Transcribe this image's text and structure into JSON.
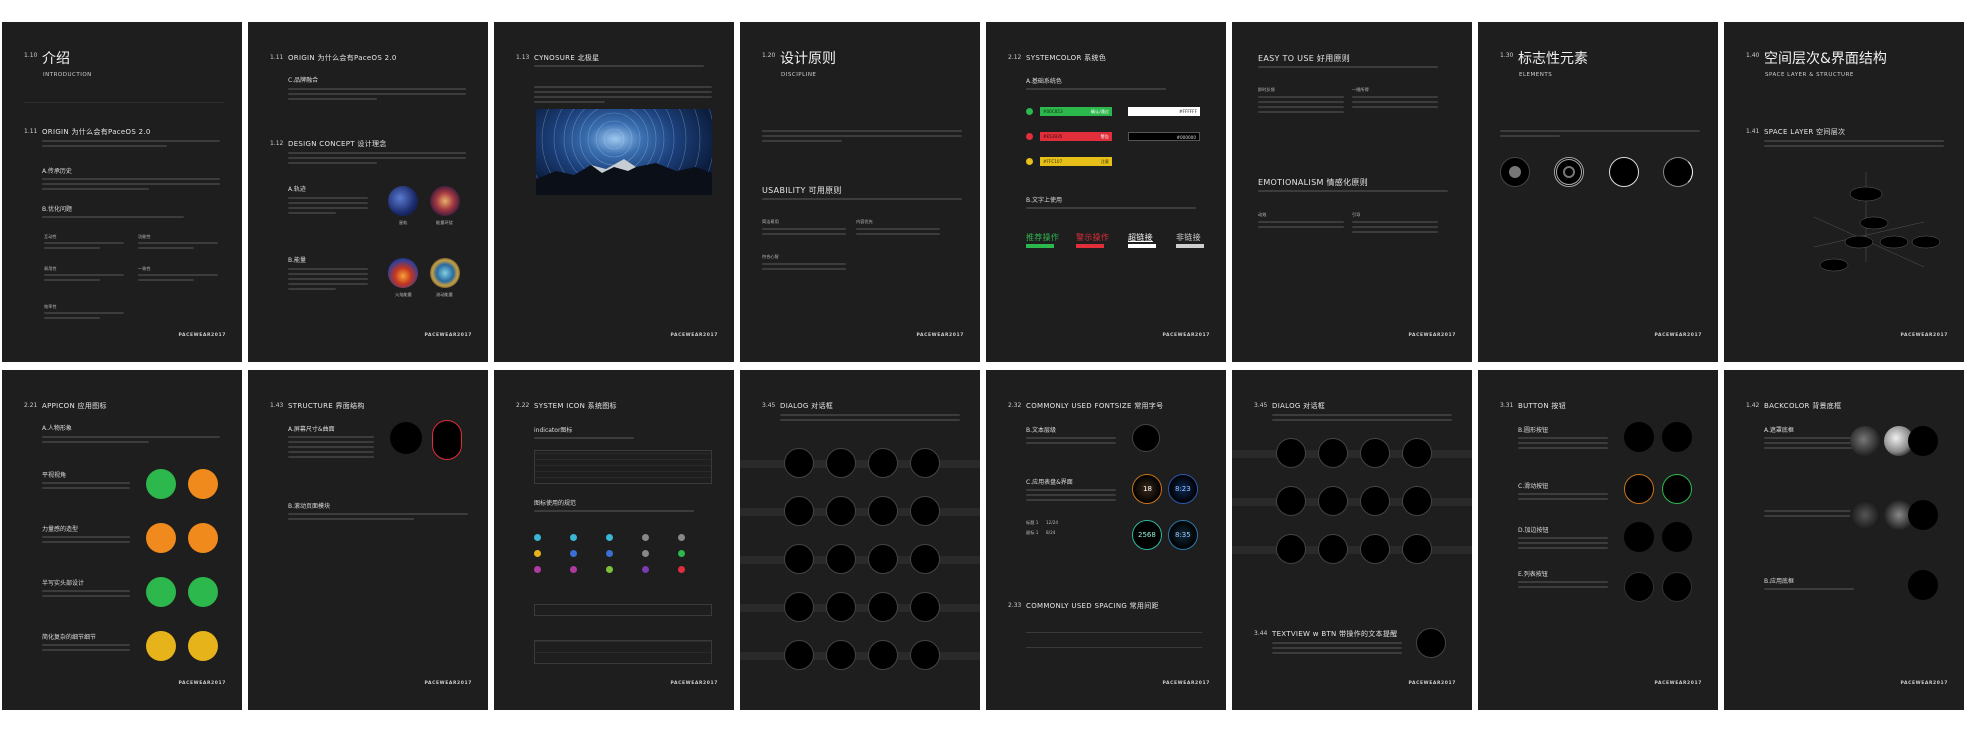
{
  "footer": "PACEWEAR2017",
  "pages": {
    "p1": {
      "num": "1.10",
      "title": "介绍",
      "subtitle": "INTRODUCTION",
      "sec_num": "1.11",
      "sec_title": "ORIGIN 为什么会有PaceOS 2.0",
      "a": "A.传承历史",
      "b": "B.优化问题",
      "c1": "互动性",
      "c2": "功能性",
      "c3": "易用性",
      "c4": "一致性",
      "c5": "效率性"
    },
    "p2": {
      "num": "1.11",
      "title": "ORIGIN 为什么会有PaceOS 2.0",
      "c": "C.品牌融合",
      "sec_num": "1.12",
      "sec_title": "DESIGN CONCEPT 设计理念",
      "a": "A.轨迹",
      "b": "B.能量",
      "cap1": "星轨",
      "cap2": "能量环绕",
      "cap3": "火焰能量",
      "cap4": "流动能量"
    },
    "p3": {
      "num": "1.13",
      "title": "CYNOSURE 北极星"
    },
    "p4": {
      "num": "1.20",
      "title": "设计原则",
      "subtitle": "DISCIPLINE",
      "sec": "USABILITY 可用原则",
      "h1": "简洁易用",
      "h2": "内容优先",
      "h3": "符合心智"
    },
    "p5": {
      "num": "2.12",
      "title": "SYSTEMCOLOR 系统色",
      "a": "A.基础系统色",
      "b": "B.文字上使用",
      "btn1": "确认/通过",
      "btn2": "警告",
      "btn3": "注意",
      "w1": "#FFFFFF",
      "w2": "#000000",
      "c1": "#00C853",
      "c2": "#E53935",
      "c3": "#FFC107",
      "big1": "推荐操作",
      "big2": "警示操作",
      "big3": "超链接",
      "big4": "非链接"
    },
    "p6": {
      "title": "EASY TO USE 好用原则",
      "t2": "EMOTIONALISM 情感化原则",
      "h1": "即时反馈",
      "h2": "一眼所得",
      "h3": "动效",
      "h4": "引导"
    },
    "p7": {
      "num": "1.30",
      "title": "标志性元素",
      "subtitle": "ELEMENTS"
    },
    "p8": {
      "num": "1.40",
      "title": "空间层次&界面结构",
      "subtitle": "SPACE LAYER & STRUCTURE",
      "sec_num": "1.41",
      "sec": "SPACE LAYER 空间层次"
    },
    "p9": {
      "num": "2.21",
      "title": "APPICON 应用图标",
      "a": "A.人物形象",
      "h1": "平视视角",
      "h2": "力量感的造型",
      "h3": "半写实头部设计",
      "h4": "简化复杂的细节细节"
    },
    "p10": {
      "num": "1.43",
      "title": "STRUCTURE 界面结构",
      "a": "A.屏幕尺寸&曲面",
      "b": "B.滚动页面模块"
    },
    "p11": {
      "num": "2.22",
      "title": "SYSTEM ICON 系统图标",
      "a": "indicator图标",
      "b": "图标使用的规范"
    },
    "p12": {
      "num": "3.45",
      "title": "DIALOG 对话框"
    },
    "p13": {
      "num": "2.32",
      "title": "COMMONLY USED FONTSIZE 常用字号",
      "a": "B.文本层级",
      "b": "C.应用表盘&界面",
      "s1": "标题 1",
      "s2": "副标 1",
      "v1": "12/24",
      "v2": "8/24",
      "w1": "18",
      "w2": "8:23",
      "w3": "2568",
      "w4": "8:35",
      "sp_num": "2.33",
      "sp_title": "COMMONLY USED SPACING 常用间距"
    },
    "p14": {
      "num": "3.45",
      "title": "DIALOG 对话框",
      "sec_num": "3.44",
      "sec": "TEXTVIEW w BTN 带操作的文本提醒"
    },
    "p15": {
      "num": "3.31",
      "title": "BUTTON 按钮",
      "a": "B.圆形按钮",
      "b": "C.滑动按钮",
      "c": "D.加边按钮",
      "d": "E.列表按钮"
    },
    "p16": {
      "num": "1.42",
      "title": "BACKCOLOR 背景底框",
      "a": "A.遮罩底框",
      "b": "B.应用底框"
    }
  },
  "colors": {
    "bg": "#1e1e1e",
    "green": "#2db84d",
    "red": "#e02e3a",
    "yellow": "#e6c019",
    "orange": "#f08a1d"
  }
}
